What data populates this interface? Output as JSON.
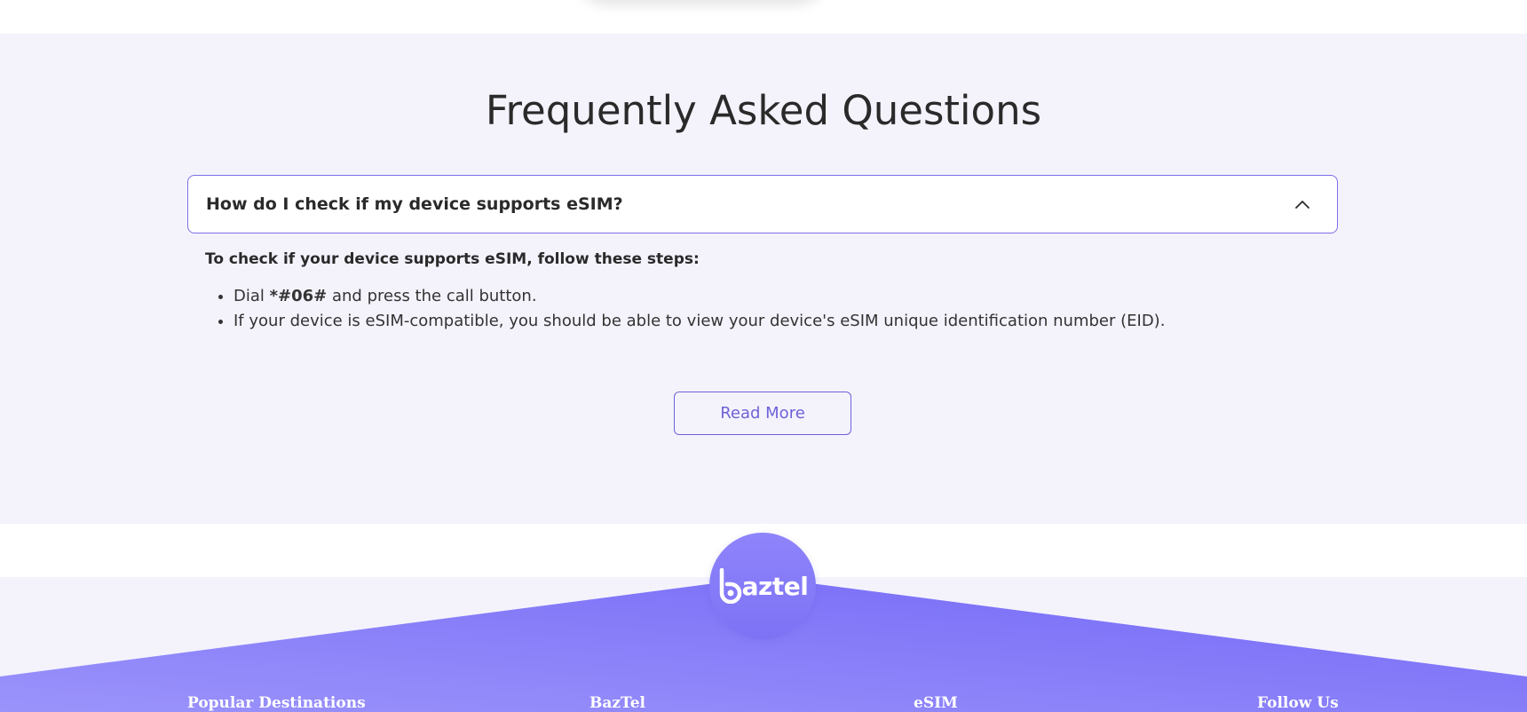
{
  "faq": {
    "title": "Frequently Asked Questions",
    "question": "How do I check if my device supports eSIM?",
    "answer_intro": "To check if your device supports eSIM, follow these steps:",
    "step1_prefix": "Dial ",
    "step1_code": "*#06#",
    "step1_suffix": " and press the call button.",
    "step2": "If your device is eSIM-compatible, you should be able to view your device's eSIM unique identification number (EID).",
    "read_more": "Read More",
    "chevron_icon": "chevron-up-icon"
  },
  "footer": {
    "logo_text": "aztel",
    "columns": [
      "Popular Destinations",
      "BazTel",
      "eSIM",
      "Follow Us"
    ]
  },
  "colors": {
    "accent": "#6e62d8",
    "section_bg": "#f4f3fc",
    "footer_gradient_start": "#9b93fb",
    "footer_gradient_end": "#7468f6"
  }
}
